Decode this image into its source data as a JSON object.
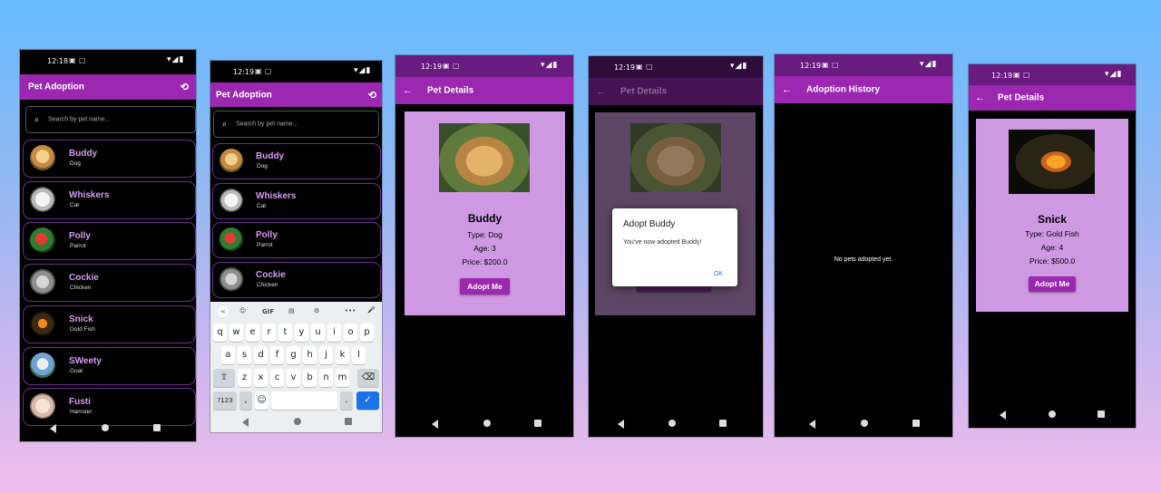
{
  "status": {
    "time_a": "12:18",
    "time_b": "12:19"
  },
  "list_screen": {
    "title": "Pet Adoption",
    "history_icon": "history-icon",
    "search_placeholder": "Search by pet name...",
    "pets": [
      {
        "name": "Buddy",
        "type": "Dog"
      },
      {
        "name": "Whiskers",
        "type": "Cat"
      },
      {
        "name": "Polly",
        "type": "Parrot"
      },
      {
        "name": "Cockie",
        "type": "Chicken"
      },
      {
        "name": "Snick",
        "type": "Gold Fish"
      },
      {
        "name": "SWeety",
        "type": "Goat"
      },
      {
        "name": "Fusti",
        "type": "Hamster"
      }
    ]
  },
  "keyboard": {
    "toolbar": [
      "<",
      "☺",
      "GIF",
      "▤",
      "⚙",
      "•••",
      "🎤"
    ],
    "row1": [
      "q",
      "w",
      "e",
      "r",
      "t",
      "y",
      "u",
      "i",
      "o",
      "p"
    ],
    "row1_hints": [
      "1",
      "2",
      "3",
      "4",
      "5",
      "6",
      "7",
      "8",
      "9",
      "0"
    ],
    "row2": [
      "a",
      "s",
      "d",
      "f",
      "g",
      "h",
      "j",
      "k",
      "l"
    ],
    "row3": [
      "z",
      "x",
      "c",
      "v",
      "b",
      "n",
      "m"
    ],
    "shift": "⇧",
    "backspace": "⌫",
    "symbols": "?123",
    "comma": ",",
    "emoji": "☺",
    "period": ".",
    "enter": "✓"
  },
  "details_buddy": {
    "title": "Pet Details",
    "name": "Buddy",
    "type_line": "Type: Dog",
    "age_line": "Age: 3",
    "price_line": "Price: $200.0",
    "button": "Adopt Me"
  },
  "dialog": {
    "title": "Adopt Buddy",
    "message": "You've now adopted Buddy!",
    "ok": "OK"
  },
  "history": {
    "title": "Adoption History",
    "empty": "No pets adopted yet."
  },
  "details_snick": {
    "title": "Pet Details",
    "name": "Snick",
    "type_line": "Type: Gold Fish",
    "age_line": "Age: 4",
    "price_line": "Price: $500.0",
    "button": "Adopt Me"
  },
  "colors": {
    "appbar": "#9c27b0",
    "status": "#6a1b80",
    "card": "#cf98e3",
    "accent": "#d79bf0"
  }
}
